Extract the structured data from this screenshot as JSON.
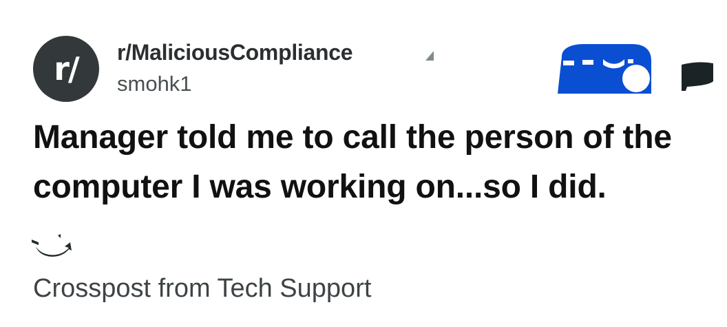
{
  "post": {
    "community": "r/MaliciousCompliance",
    "username": "smohk1",
    "avatar_text": "r/",
    "title": "Manager told me to call the person of the computer I was working on...so I did.",
    "crosspost_label": "Crosspost from Tech Support"
  },
  "icons": {
    "avatar": "subreddit-avatar-icon",
    "small_triangle": "corner-triangle-icon",
    "blue_badge": "blue-badge-icon",
    "dark_shape": "dark-flag-icon",
    "crosspost": "crosspost-icon"
  },
  "colors": {
    "avatar_bg": "#33383a",
    "badge_blue": "#0a4fd1",
    "dark_shape": "#1c2326",
    "text_primary": "#111111",
    "text_secondary": "#4a4f52"
  }
}
